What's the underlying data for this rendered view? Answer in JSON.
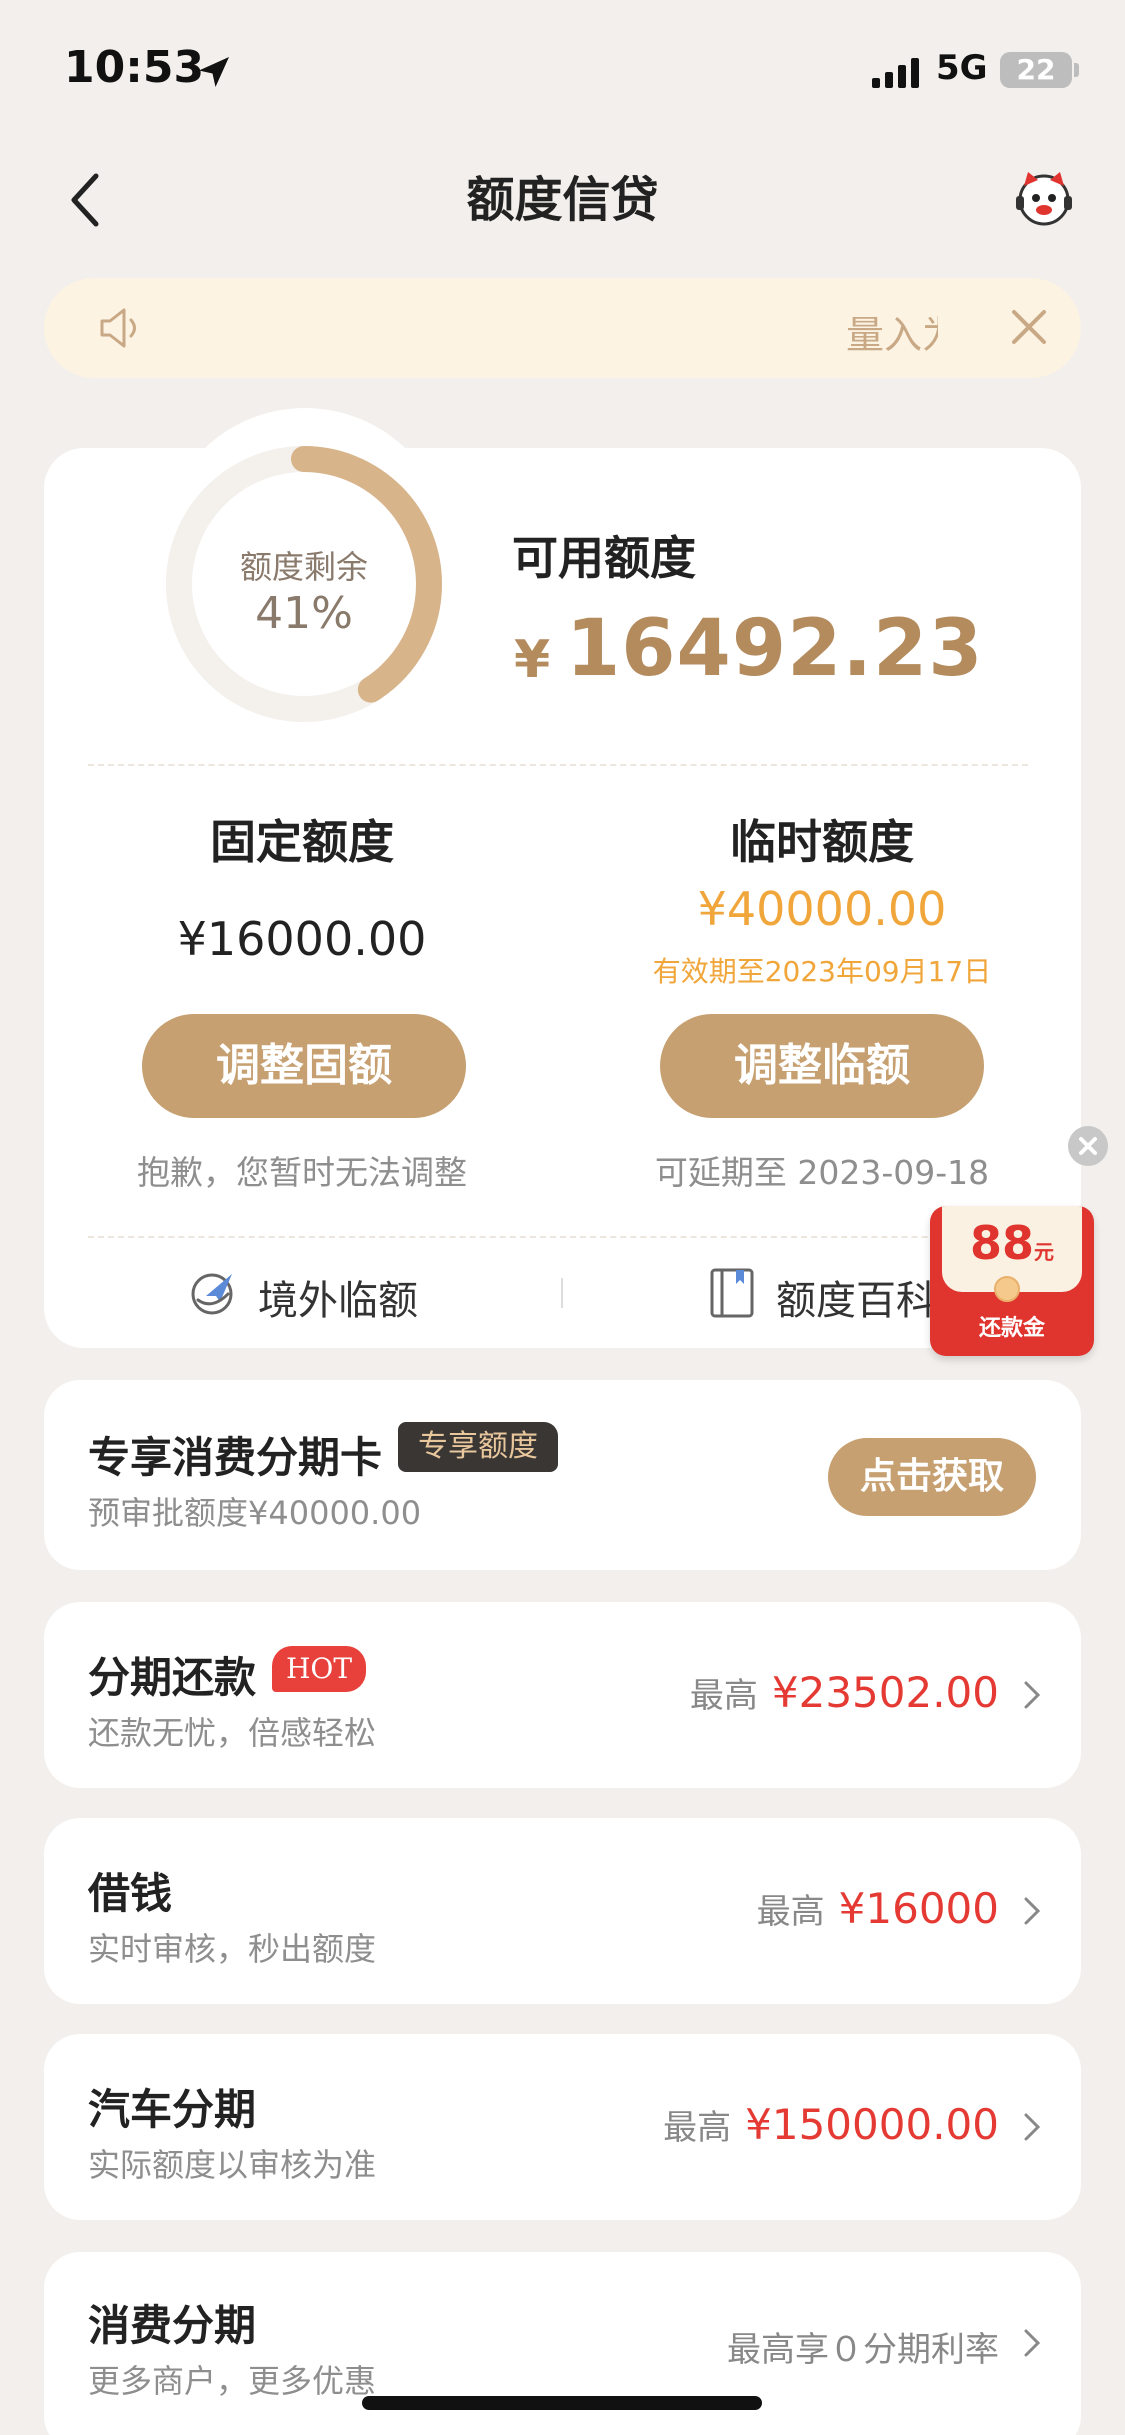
{
  "status_bar": {
    "time": "10:53",
    "network": "5G",
    "battery": "22"
  },
  "nav": {
    "title": "额度信贷"
  },
  "notice": {
    "text": "量入为出"
  },
  "credit": {
    "ring_label": "额度剩余",
    "ring_percent_text": "41%",
    "ring_fraction": 0.41,
    "available_label": "可用额度",
    "currency": "¥",
    "available_amount": "16492.23",
    "fixed": {
      "title": "固定额度",
      "amount": "¥16000.00",
      "button": "调整固额",
      "note": "抱歉，您暂时无法调整"
    },
    "temp": {
      "title": "临时额度",
      "amount": "¥40000.00",
      "expiry": "有效期至2023年09月17日",
      "button": "调整临额",
      "note": "可延期至 2023-09-18"
    },
    "links": {
      "overseas": "境外临额",
      "wiki": "额度百科"
    }
  },
  "red_packet": {
    "amount": "88",
    "unit": "元",
    "label": "还款金"
  },
  "cards": {
    "installment_card": {
      "title": "专享消费分期卡",
      "badge": "专享额度",
      "sub": "预审批额度¥40000.00",
      "button": "点击获取"
    },
    "repay_installment": {
      "title": "分期还款",
      "badge": "HOT",
      "sub": "还款无忧，倍感轻松",
      "prefix": "最高",
      "amount": "¥23502.00"
    },
    "borrow": {
      "title": "借钱",
      "sub": "实时审核，秒出额度",
      "prefix": "最高",
      "amount": "¥16000"
    },
    "car": {
      "title": "汽车分期",
      "sub": "实际额度以审核为准",
      "prefix": "最高",
      "amount": "¥150000.00"
    },
    "consumer": {
      "title": "消费分期",
      "sub": "更多商户，更多优惠",
      "right": "最高享０分期利率"
    }
  },
  "colors": {
    "accent": "#c6a071",
    "gold_text": "#b38b5d",
    "orange": "#f0a63a",
    "red": "#e53a33"
  }
}
